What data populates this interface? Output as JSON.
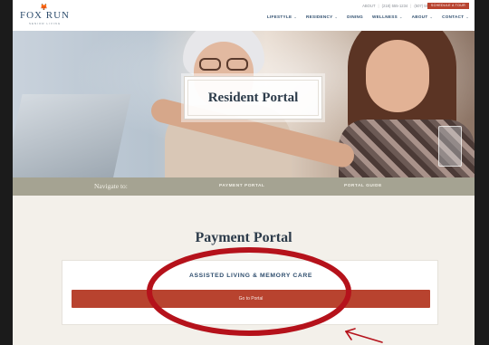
{
  "brand": {
    "fox_mark": "🦊",
    "name": "FOX RUN",
    "tagline": "SENIOR LIVING"
  },
  "utility": {
    "links": [
      "ABOUT",
      "(218) 555-1234",
      "(507) 555-7000"
    ],
    "tour_button": "SCHEDULE A TOUR"
  },
  "nav": {
    "items": [
      {
        "label": "LIFESTYLE",
        "chevron": "⌄"
      },
      {
        "label": "RESIDENCY",
        "chevron": "⌄"
      },
      {
        "label": "DINING",
        "chevron": ""
      },
      {
        "label": "WELLNESS",
        "chevron": "⌄"
      },
      {
        "label": "ABOUT",
        "chevron": "⌄"
      },
      {
        "label": "CONTACT",
        "chevron": "⌄"
      }
    ]
  },
  "hero": {
    "title": "Resident Portal"
  },
  "subnav": {
    "label": "Navigate to:",
    "links": [
      "PAYMENT PORTAL",
      "PORTAL GUIDE"
    ]
  },
  "main": {
    "section_title": "Payment Portal",
    "card_label": "ASSISTED LIVING & MEMORY CARE",
    "button_label": "Go to Portal"
  },
  "colors": {
    "accent": "#b8432f",
    "navy": "#2f4e6e",
    "subnav_bg": "#a5a392",
    "annotation": "#b5121b"
  }
}
